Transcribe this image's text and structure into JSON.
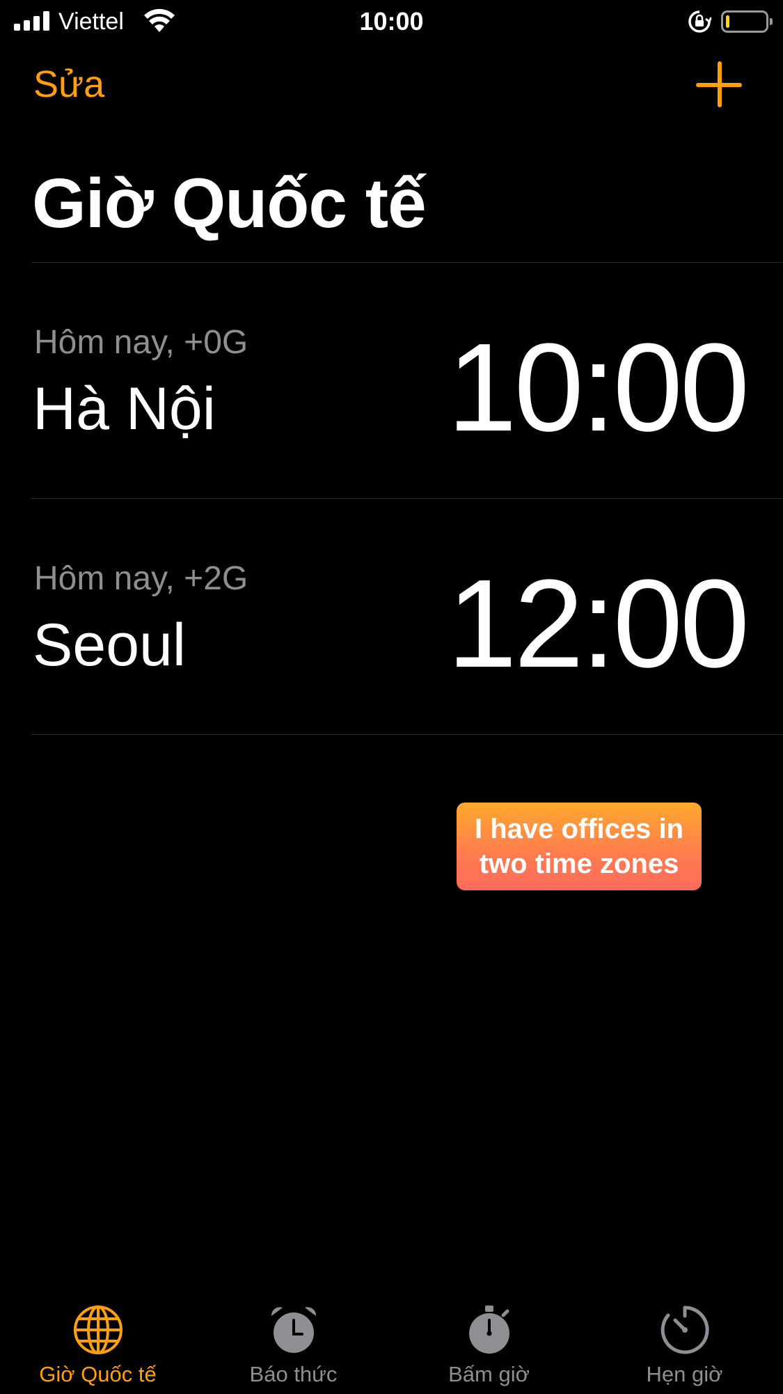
{
  "status_bar": {
    "carrier": "Viettel",
    "time": "10:00",
    "battery_level": 0.1
  },
  "nav": {
    "edit_label": "Sửa"
  },
  "page": {
    "title": "Giờ Quốc tế"
  },
  "clocks": [
    {
      "offset": "Hôm nay, +0G",
      "city": "Hà Nội",
      "time": "10:00"
    },
    {
      "offset": "Hôm nay, +2G",
      "city": "Seoul",
      "time": "12:00"
    }
  ],
  "caption": {
    "line1": "I have offices in",
    "line2": "two time zones"
  },
  "tabs": [
    {
      "label": "Giờ Quốc tế",
      "icon": "globe-icon",
      "active": true
    },
    {
      "label": "Báo thức",
      "icon": "alarm-clock-icon",
      "active": false
    },
    {
      "label": "Bấm giờ",
      "icon": "stopwatch-icon",
      "active": false
    },
    {
      "label": "Hẹn giờ",
      "icon": "timer-icon",
      "active": false
    }
  ],
  "colors": {
    "accent": "#ff9f0a",
    "inactive": "#8e8e93",
    "background": "#000000"
  }
}
